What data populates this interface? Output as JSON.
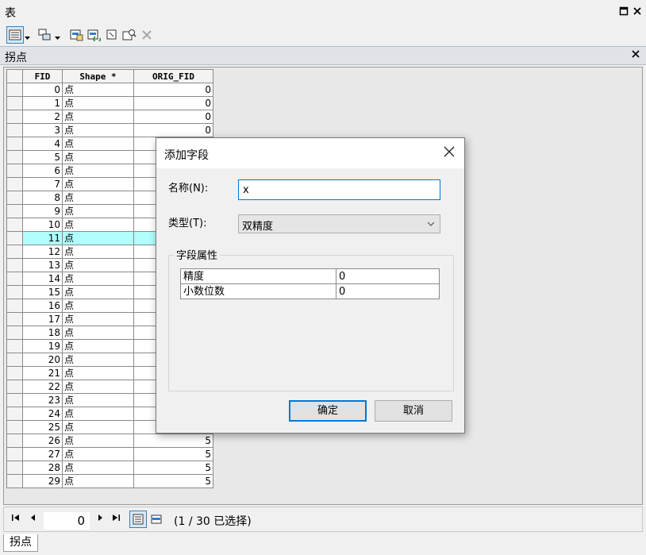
{
  "window": {
    "title": "表"
  },
  "table_tab": {
    "name": "拐点"
  },
  "grid": {
    "columns": [
      "FID",
      "Shape *",
      "ORIG_FID"
    ],
    "rows": [
      [
        "0",
        "点",
        "0"
      ],
      [
        "1",
        "点",
        "0"
      ],
      [
        "2",
        "点",
        "0"
      ],
      [
        "3",
        "点",
        "0"
      ],
      [
        "4",
        "点",
        ""
      ],
      [
        "5",
        "点",
        ""
      ],
      [
        "6",
        "点",
        ""
      ],
      [
        "7",
        "点",
        ""
      ],
      [
        "8",
        "点",
        ""
      ],
      [
        "9",
        "点",
        ""
      ],
      [
        "10",
        "点",
        ""
      ],
      [
        "11",
        "点",
        ""
      ],
      [
        "12",
        "点",
        ""
      ],
      [
        "13",
        "点",
        ""
      ],
      [
        "14",
        "点",
        ""
      ],
      [
        "15",
        "点",
        ""
      ],
      [
        "16",
        "点",
        ""
      ],
      [
        "17",
        "点",
        ""
      ],
      [
        "18",
        "点",
        ""
      ],
      [
        "19",
        "点",
        ""
      ],
      [
        "20",
        "点",
        ""
      ],
      [
        "21",
        "点",
        ""
      ],
      [
        "22",
        "点",
        ""
      ],
      [
        "23",
        "点",
        ""
      ],
      [
        "24",
        "点",
        ""
      ],
      [
        "25",
        "点",
        ""
      ],
      [
        "26",
        "点",
        "5"
      ],
      [
        "27",
        "点",
        "5"
      ],
      [
        "28",
        "点",
        "5"
      ],
      [
        "29",
        "点",
        "5"
      ]
    ],
    "highlight_row": 11
  },
  "nav": {
    "current_record": "0",
    "selection_info": "(1 / 30 已选择)"
  },
  "bottom_tab": {
    "label": "拐点"
  },
  "dialog": {
    "title": "添加字段",
    "name_label": "名称(N):",
    "name_value": "x",
    "type_label": "类型(T):",
    "type_value": "双精度",
    "props_legend": "字段属性",
    "props": [
      {
        "key": "精度",
        "value": "0"
      },
      {
        "key": "小数位数",
        "value": "0"
      }
    ],
    "ok_label": "确定",
    "cancel_label": "取消"
  },
  "colors": {
    "highlight": "#b0fffd",
    "focus_border": "#0078d7"
  }
}
